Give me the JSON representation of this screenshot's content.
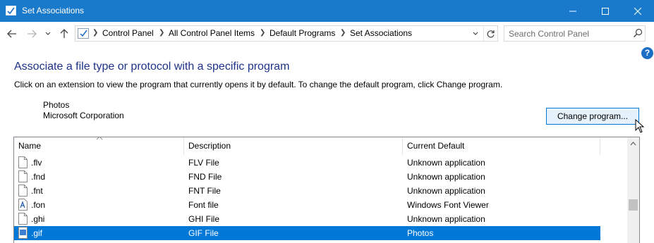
{
  "window": {
    "title": "Set Associations"
  },
  "nav": {
    "breadcrumbs": [
      "Control Panel",
      "All Control Panel Items",
      "Default Programs",
      "Set Associations"
    ],
    "search_placeholder": "Search Control Panel"
  },
  "page": {
    "heading": "Associate a file type or protocol with a specific program",
    "instructions": "Click on an extension to view the program that currently opens it by default. To change the default program, click Change program.",
    "current_program": {
      "name": "Photos",
      "publisher": "Microsoft Corporation"
    },
    "change_button_label": "Change program..."
  },
  "list": {
    "columns": [
      "Name",
      "Description",
      "Current Default"
    ],
    "rows": [
      {
        "name": ".flv",
        "description": "FLV File",
        "current_default": "Unknown application",
        "icon": "blank-file-icon",
        "selected": false
      },
      {
        "name": ".fnd",
        "description": "FND File",
        "current_default": "Unknown application",
        "icon": "blank-file-icon",
        "selected": false
      },
      {
        "name": ".fnt",
        "description": "FNT File",
        "current_default": "Unknown application",
        "icon": "blank-file-icon",
        "selected": false
      },
      {
        "name": ".fon",
        "description": "Font file",
        "current_default": "Windows Font Viewer",
        "icon": "font-file-icon",
        "selected": false
      },
      {
        "name": ".ghi",
        "description": "GHI File",
        "current_default": "Unknown application",
        "icon": "blank-file-icon",
        "selected": false
      },
      {
        "name": ".gif",
        "description": "GIF File",
        "current_default": "Photos",
        "icon": "image-file-icon",
        "selected": true
      }
    ]
  },
  "colors": {
    "titlebar": "#1979ca",
    "selection": "#0078d7",
    "heading": "#1e3287"
  }
}
